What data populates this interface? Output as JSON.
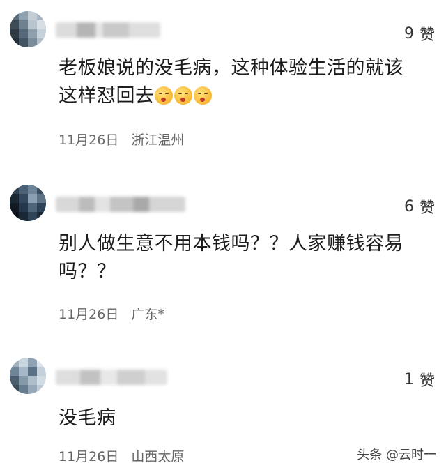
{
  "comments": [
    {
      "likes": "9",
      "like_label": "赞",
      "text_line1": "老板娘说的没毛病，这种体验生活的就该",
      "text_line2": "这样怼回去",
      "emoji": [
        "shushing-face-icon",
        "shushing-face-icon",
        "shushing-face-icon"
      ],
      "date": "11月26日",
      "location": "浙江温州"
    },
    {
      "likes": "6",
      "like_label": "赞",
      "text_line1": "别人做生意不用本钱吗？？人家赚钱容易",
      "text_line2": "吗？？",
      "date": "11月26日",
      "location": "广东*"
    },
    {
      "likes": "1",
      "like_label": "赞",
      "text_line1": "没毛病",
      "date": "11月26日",
      "location": "山西太原"
    }
  ],
  "watermark": "头条 @云时一"
}
